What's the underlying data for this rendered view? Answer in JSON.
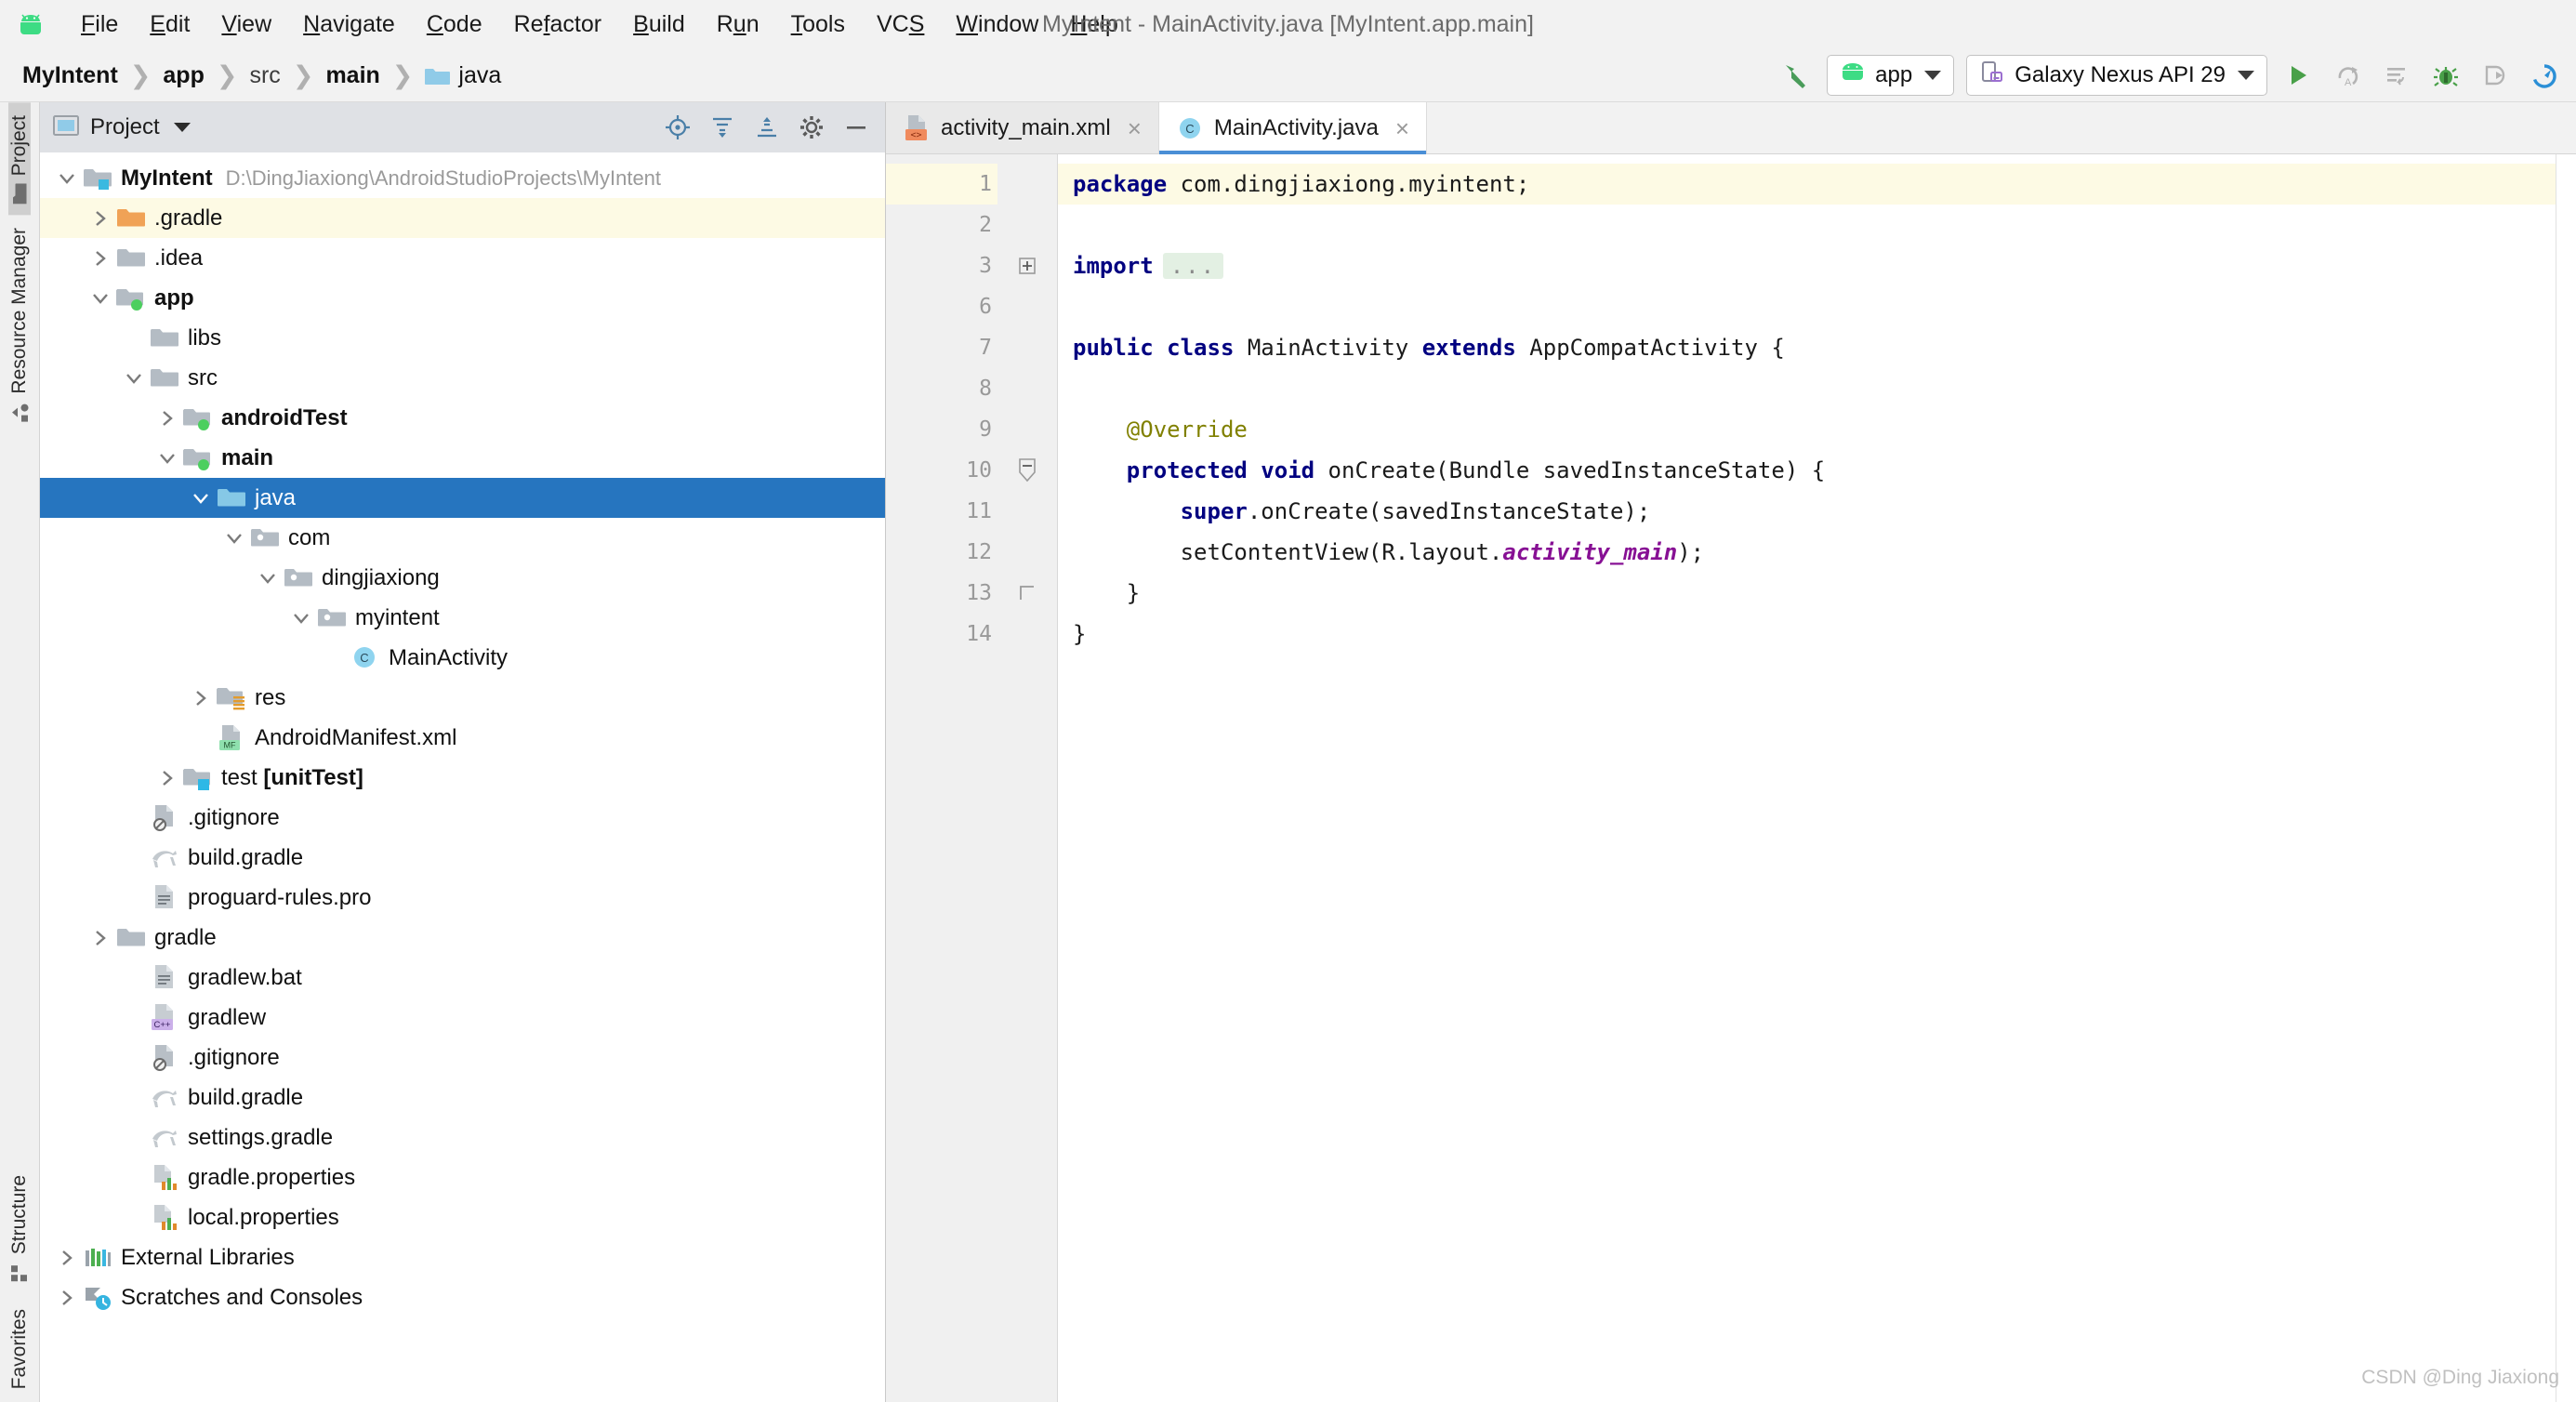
{
  "window": {
    "title": "MyIntent - MainActivity.java [MyIntent.app.main]",
    "logo_icon": "android-logo-icon"
  },
  "menubar": {
    "items": [
      {
        "label": "File",
        "mnemonic": "F"
      },
      {
        "label": "Edit",
        "mnemonic": "E"
      },
      {
        "label": "View",
        "mnemonic": "V"
      },
      {
        "label": "Navigate",
        "mnemonic": "N"
      },
      {
        "label": "Code",
        "mnemonic": "C"
      },
      {
        "label": "Refactor",
        "mnemonic": "f"
      },
      {
        "label": "Build",
        "mnemonic": "B"
      },
      {
        "label": "Run",
        "mnemonic": "u"
      },
      {
        "label": "Tools",
        "mnemonic": "T"
      },
      {
        "label": "VCS",
        "mnemonic": "S"
      },
      {
        "label": "Window",
        "mnemonic": "W"
      },
      {
        "label": "Help",
        "mnemonic": "H"
      }
    ]
  },
  "navbar": {
    "breadcrumb": [
      {
        "label": "MyIntent",
        "bold": true,
        "icon": ""
      },
      {
        "label": "app",
        "bold": true,
        "icon": ""
      },
      {
        "label": "src",
        "bold": false,
        "icon": ""
      },
      {
        "label": "main",
        "bold": true,
        "icon": ""
      },
      {
        "label": "java",
        "bold": false,
        "icon": "folder-blue-icon"
      }
    ],
    "separator": "❯",
    "build_icon": "hammer-build-icon",
    "run_config": {
      "label": "app",
      "icon": "android-head-icon"
    },
    "device": {
      "label": "Galaxy Nexus API 29",
      "icon": "device-phone-icon"
    },
    "actions": [
      {
        "name": "run-button",
        "icon": "play-triangle-green-icon",
        "enabled": true
      },
      {
        "name": "apply-changes-restart-button",
        "icon": "apply-changes-restart-icon",
        "enabled": false
      },
      {
        "name": "apply-code-changes-button",
        "icon": "apply-code-changes-icon",
        "enabled": false
      },
      {
        "name": "debug-button",
        "icon": "bug-green-icon",
        "enabled": true
      },
      {
        "name": "attach-debugger-button",
        "icon": "attach-debugger-icon",
        "enabled": false
      },
      {
        "name": "profiler-button",
        "icon": "profiler-gauge-icon",
        "enabled": true
      }
    ]
  },
  "toolstrip": {
    "top": [
      {
        "label": "Project",
        "icon": "folder-icon",
        "active": true
      },
      {
        "label": "Resource Manager",
        "icon": "resource-shapes-icon",
        "active": false
      }
    ],
    "bottom": [
      {
        "label": "Structure",
        "icon": "structure-squares-icon",
        "active": false
      },
      {
        "label": "Favorites",
        "icon": "favorites-icon",
        "active": false
      }
    ]
  },
  "project_panel": {
    "header": {
      "title": "Project",
      "icon": "project-window-icon"
    },
    "header_tools": [
      {
        "name": "locate-in-tree-button",
        "icon": "target-crosshair-icon"
      },
      {
        "name": "expand-all-button",
        "icon": "expand-all-icon"
      },
      {
        "name": "collapse-all-button",
        "icon": "collapse-all-icon"
      },
      {
        "name": "settings-button",
        "icon": "gear-icon"
      },
      {
        "name": "hide-button",
        "icon": "minus-icon"
      }
    ],
    "tree": [
      {
        "indent": 0,
        "arrow": "down",
        "icon": "module-folder-icon",
        "label": "MyIntent",
        "bold": true,
        "path": "D:\\DingJiaxiong\\AndroidStudioProjects\\MyIntent",
        "state": "normal"
      },
      {
        "indent": 1,
        "arrow": "right",
        "icon": "folder-orange-icon",
        "label": ".gradle",
        "bold": false,
        "path": "",
        "state": "highlight"
      },
      {
        "indent": 1,
        "arrow": "right",
        "icon": "folder-gray-icon",
        "label": ".idea",
        "bold": false,
        "path": "",
        "state": "normal"
      },
      {
        "indent": 1,
        "arrow": "down",
        "icon": "module-green-icon",
        "label": "app",
        "bold": true,
        "path": "",
        "state": "normal"
      },
      {
        "indent": 2,
        "arrow": "none",
        "icon": "folder-gray-icon",
        "label": "libs",
        "bold": false,
        "path": "",
        "state": "normal"
      },
      {
        "indent": 2,
        "arrow": "down",
        "icon": "folder-gray-icon",
        "label": "src",
        "bold": false,
        "path": "",
        "state": "normal"
      },
      {
        "indent": 3,
        "arrow": "right",
        "icon": "module-green-icon",
        "label": "androidTest",
        "bold": true,
        "path": "",
        "state": "normal"
      },
      {
        "indent": 3,
        "arrow": "down",
        "icon": "module-green-icon",
        "label": "main",
        "bold": true,
        "path": "",
        "state": "normal"
      },
      {
        "indent": 4,
        "arrow": "down",
        "icon": "folder-blue-icon",
        "label": "java",
        "bold": false,
        "path": "",
        "state": "selected"
      },
      {
        "indent": 5,
        "arrow": "down",
        "icon": "package-icon",
        "label": "com",
        "bold": false,
        "path": "",
        "state": "normal"
      },
      {
        "indent": 6,
        "arrow": "down",
        "icon": "package-icon",
        "label": "dingjiaxiong",
        "bold": false,
        "path": "",
        "state": "normal"
      },
      {
        "indent": 7,
        "arrow": "down",
        "icon": "package-icon",
        "label": "myintent",
        "bold": false,
        "path": "",
        "state": "normal"
      },
      {
        "indent": 8,
        "arrow": "none",
        "icon": "java-class-icon",
        "label": "MainActivity",
        "bold": false,
        "path": "",
        "state": "normal"
      },
      {
        "indent": 4,
        "arrow": "right",
        "icon": "res-folder-icon",
        "label": "res",
        "bold": false,
        "path": "",
        "state": "normal"
      },
      {
        "indent": 4,
        "arrow": "none",
        "icon": "manifest-file-icon",
        "label": "AndroidManifest.xml",
        "bold": false,
        "path": "",
        "state": "normal"
      },
      {
        "indent": 3,
        "arrow": "right",
        "icon": "module-blue-icon",
        "label": "test [unitTest]",
        "bold": false,
        "path": "",
        "state": "normal",
        "bold_suffix": "[unitTest]"
      },
      {
        "indent": 2,
        "arrow": "none",
        "icon": "gitignore-file-icon",
        "label": ".gitignore",
        "bold": false,
        "path": "",
        "state": "normal"
      },
      {
        "indent": 2,
        "arrow": "none",
        "icon": "gradle-file-icon",
        "label": "build.gradle",
        "bold": false,
        "path": "",
        "state": "normal"
      },
      {
        "indent": 2,
        "arrow": "none",
        "icon": "text-file-icon",
        "label": "proguard-rules.pro",
        "bold": false,
        "path": "",
        "state": "normal"
      },
      {
        "indent": 1,
        "arrow": "right",
        "icon": "folder-gray-icon",
        "label": "gradle",
        "bold": false,
        "path": "",
        "state": "normal"
      },
      {
        "indent": 2,
        "arrow": "none",
        "icon": "text-file-icon",
        "label": "gradlew.bat",
        "bold": false,
        "path": "",
        "state": "normal"
      },
      {
        "indent": 2,
        "arrow": "none",
        "icon": "cpp-file-icon",
        "label": "gradlew",
        "bold": false,
        "path": "",
        "state": "normal"
      },
      {
        "indent": 2,
        "arrow": "none",
        "icon": "gitignore-file-icon",
        "label": ".gitignore",
        "bold": false,
        "path": "",
        "state": "normal"
      },
      {
        "indent": 2,
        "arrow": "none",
        "icon": "gradle-file-icon",
        "label": "build.gradle",
        "bold": false,
        "path": "",
        "state": "normal"
      },
      {
        "indent": 2,
        "arrow": "none",
        "icon": "gradle-file-icon",
        "label": "settings.gradle",
        "bold": false,
        "path": "",
        "state": "normal"
      },
      {
        "indent": 2,
        "arrow": "none",
        "icon": "properties-file-icon",
        "label": "gradle.properties",
        "bold": false,
        "path": "",
        "state": "normal"
      },
      {
        "indent": 2,
        "arrow": "none",
        "icon": "properties-file-icon",
        "label": "local.properties",
        "bold": false,
        "path": "",
        "state": "normal"
      },
      {
        "indent": 0,
        "arrow": "right",
        "icon": "libraries-icon",
        "label": "External Libraries",
        "bold": false,
        "path": "",
        "state": "normal"
      },
      {
        "indent": 0,
        "arrow": "right",
        "icon": "scratches-icon",
        "label": "Scratches and Consoles",
        "bold": false,
        "path": "",
        "state": "normal"
      }
    ]
  },
  "editor": {
    "tabs": [
      {
        "label": "activity_main.xml",
        "icon": "xml-layout-file-icon",
        "active": false,
        "close": "×"
      },
      {
        "label": "MainActivity.java",
        "icon": "java-class-icon",
        "active": true,
        "close": "×"
      }
    ],
    "line_numbers": [
      "1",
      "2",
      "3",
      "6",
      "7",
      "8",
      "9",
      "10",
      "11",
      "12",
      "13",
      "14"
    ],
    "gutter_marks": [
      {
        "line": "7",
        "icon": "related-xml-layout-icon"
      },
      {
        "line": "10",
        "icon": "overriding-method-icon"
      }
    ],
    "lines": [
      {
        "num": "1",
        "current": true,
        "indent": 0,
        "tokens": [
          {
            "t": "kw",
            "v": "package"
          },
          {
            "t": "plain",
            "v": " com.dingjiaxiong.myintent;"
          }
        ]
      },
      {
        "num": "2",
        "current": false,
        "indent": 0,
        "tokens": []
      },
      {
        "num": "3",
        "current": false,
        "indent": 0,
        "tokens": [
          {
            "t": "kw",
            "v": "import"
          },
          {
            "t": "fold",
            "v": "..."
          }
        ]
      },
      {
        "num": "6",
        "current": false,
        "indent": 0,
        "tokens": []
      },
      {
        "num": "7",
        "current": false,
        "indent": 0,
        "tokens": [
          {
            "t": "kw",
            "v": "public class"
          },
          {
            "t": "plain",
            "v": " MainActivity "
          },
          {
            "t": "kw",
            "v": "extends"
          },
          {
            "t": "plain",
            "v": " AppCompatActivity {"
          }
        ]
      },
      {
        "num": "8",
        "current": false,
        "indent": 0,
        "tokens": []
      },
      {
        "num": "9",
        "current": false,
        "indent": 1,
        "tokens": [
          {
            "t": "anno",
            "v": "@Override"
          }
        ]
      },
      {
        "num": "10",
        "current": false,
        "indent": 1,
        "tokens": [
          {
            "t": "kw",
            "v": "protected void"
          },
          {
            "t": "plain",
            "v": " onCreate(Bundle savedInstanceState) {"
          }
        ]
      },
      {
        "num": "11",
        "current": false,
        "indent": 2,
        "tokens": [
          {
            "t": "kw",
            "v": "super"
          },
          {
            "t": "plain",
            "v": ".onCreate(savedInstanceState);"
          }
        ]
      },
      {
        "num": "12",
        "current": false,
        "indent": 2,
        "tokens": [
          {
            "t": "plain",
            "v": "setContentView(R.layout."
          },
          {
            "t": "static",
            "v": "activity_main"
          },
          {
            "t": "plain",
            "v": ");"
          }
        ]
      },
      {
        "num": "13",
        "current": false,
        "indent": 1,
        "tokens": [
          {
            "t": "plain",
            "v": "}"
          }
        ]
      },
      {
        "num": "14",
        "current": false,
        "indent": 0,
        "tokens": [
          {
            "t": "plain",
            "v": "}"
          }
        ]
      }
    ]
  },
  "watermark": "CSDN @Ding Jiaxiong",
  "colors": {
    "accent_blue": "#2675bf",
    "keyword_navy": "#000080",
    "annotation_olive": "#808000",
    "static_purple": "#871094",
    "caret_line": "#fdfae4",
    "panel_header": "#dfe1e5",
    "android_green": "#3ddc84"
  }
}
